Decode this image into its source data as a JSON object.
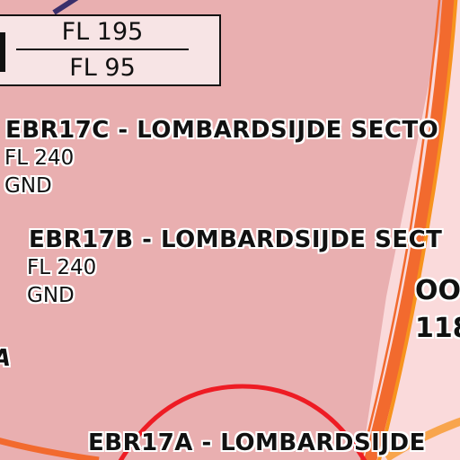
{
  "colors": {
    "restricted_area_fill": "#e9afb0",
    "adjacent_area_fill": "#fadadb",
    "boundary_orange": "#f26a2e",
    "boundary_orange_light": "#f7931e",
    "circle_red": "#ee1c24",
    "label_halo": "#ffffff",
    "label_text": "#111111"
  },
  "fl_box": {
    "upper": "FL 195",
    "lower": "FL 95"
  },
  "areas": [
    {
      "name": "EBR17C - LOMBARDSIJDE SECTO",
      "upper": "FL 240",
      "lower": "GND"
    },
    {
      "name": "EBR17B - LOMBARDSIJDE SECT",
      "upper": "FL 240",
      "lower": "GND"
    },
    {
      "name": "EBR17A - LOMBARDSIJDE",
      "upper": "",
      "lower": ""
    }
  ],
  "adjacent": {
    "label_top": "OO",
    "label_bottom": "118"
  },
  "edge_fragment": "A"
}
